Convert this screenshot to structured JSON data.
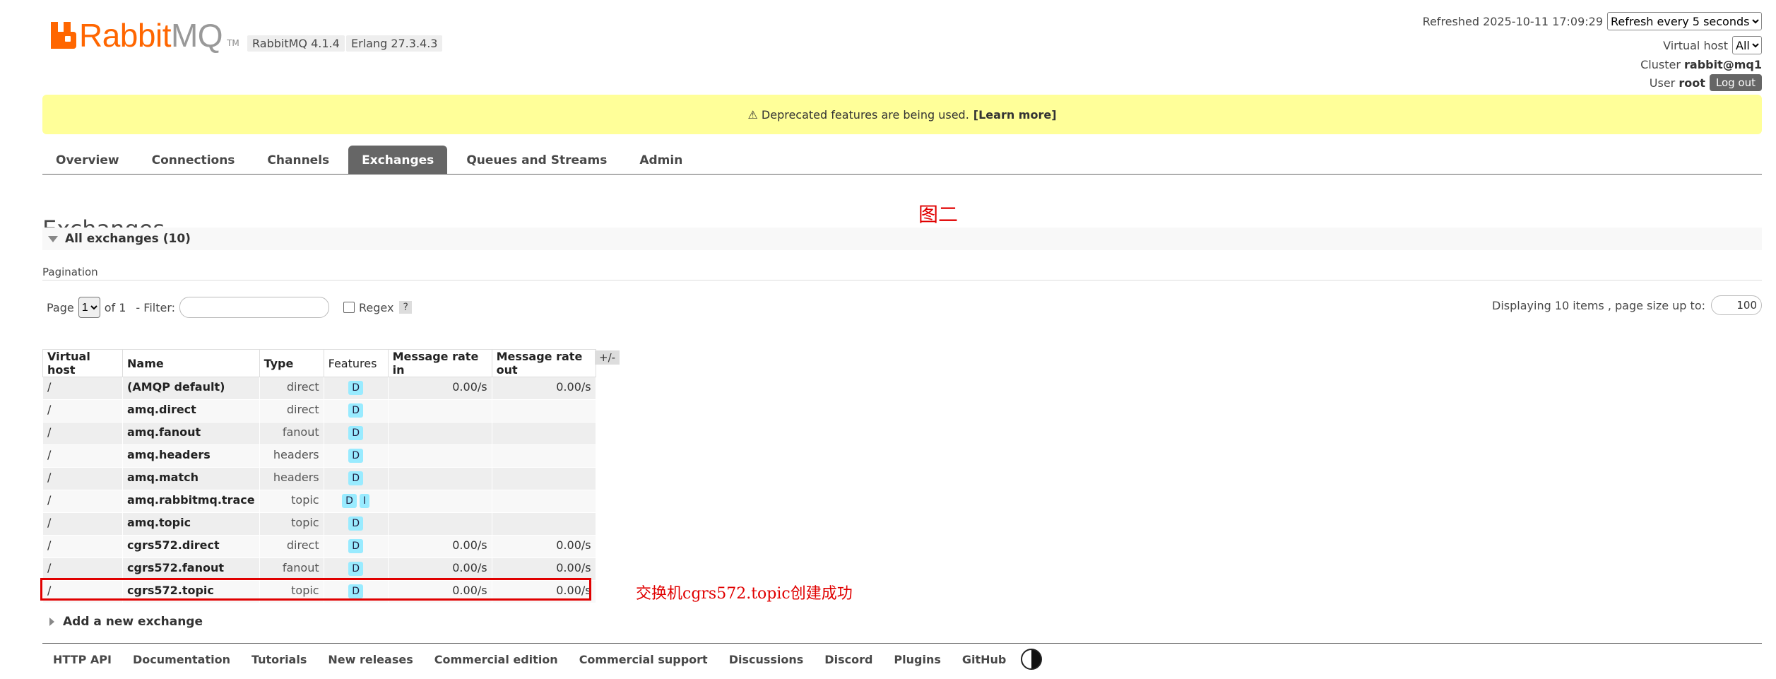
{
  "logo": {
    "word1": "Rabbit",
    "word2": "MQ",
    "tm": "TM",
    "version": "RabbitMQ 4.1.4",
    "erlang": "Erlang 27.3.4.3"
  },
  "topright": {
    "refreshed": "Refreshed 2025-10-11 17:09:29",
    "refresh_option": "Refresh every 5 seconds",
    "vhost_label": "Virtual host",
    "vhost_value": "All",
    "cluster_label": "Cluster",
    "cluster_value": "rabbit@mq1",
    "user_label": "User",
    "user_value": "root",
    "logout": "Log out"
  },
  "banner": {
    "text": "⚠ Deprecated features are being used.",
    "link": "[Learn more]"
  },
  "tabs": [
    {
      "label": "Overview"
    },
    {
      "label": "Connections"
    },
    {
      "label": "Channels"
    },
    {
      "label": "Exchanges",
      "active": true
    },
    {
      "label": "Queues and Streams"
    },
    {
      "label": "Admin"
    }
  ],
  "page_title": "Exchanges",
  "annotation_top": "图二",
  "section": {
    "title": "All exchanges (10)"
  },
  "pagination": {
    "label": "Pagination",
    "page_label": "Page",
    "page_value": "1",
    "of": "of 1",
    "filter_label": "- Filter:",
    "regex_label": "Regex",
    "help": "?",
    "display_text": "Displaying 10 items , page size up to:",
    "page_size": "100"
  },
  "table": {
    "headers": [
      "Virtual host",
      "Name",
      "Type",
      "Features",
      "Message rate in",
      "Message rate out"
    ],
    "plusminus": "+/-",
    "rows": [
      {
        "vhost": "/",
        "name": "(AMQP default)",
        "type": "direct",
        "features": [
          "D"
        ],
        "in": "0.00/s",
        "out": "0.00/s"
      },
      {
        "vhost": "/",
        "name": "amq.direct",
        "type": "direct",
        "features": [
          "D"
        ],
        "in": "",
        "out": ""
      },
      {
        "vhost": "/",
        "name": "amq.fanout",
        "type": "fanout",
        "features": [
          "D"
        ],
        "in": "",
        "out": ""
      },
      {
        "vhost": "/",
        "name": "amq.headers",
        "type": "headers",
        "features": [
          "D"
        ],
        "in": "",
        "out": ""
      },
      {
        "vhost": "/",
        "name": "amq.match",
        "type": "headers",
        "features": [
          "D"
        ],
        "in": "",
        "out": ""
      },
      {
        "vhost": "/",
        "name": "amq.rabbitmq.trace",
        "type": "topic",
        "features": [
          "D",
          "I"
        ],
        "in": "",
        "out": ""
      },
      {
        "vhost": "/",
        "name": "amq.topic",
        "type": "topic",
        "features": [
          "D"
        ],
        "in": "",
        "out": ""
      },
      {
        "vhost": "/",
        "name": "cgrs572.direct",
        "type": "direct",
        "features": [
          "D"
        ],
        "in": "0.00/s",
        "out": "0.00/s"
      },
      {
        "vhost": "/",
        "name": "cgrs572.fanout",
        "type": "fanout",
        "features": [
          "D"
        ],
        "in": "0.00/s",
        "out": "0.00/s"
      },
      {
        "vhost": "/",
        "name": "cgrs572.topic",
        "type": "topic",
        "features": [
          "D"
        ],
        "in": "0.00/s",
        "out": "0.00/s"
      }
    ]
  },
  "annotation_row": "交换机cgrs572.topic创建成功",
  "add_new": "Add a new exchange",
  "footer": [
    "HTTP API",
    "Documentation",
    "Tutorials",
    "New releases",
    "Commercial edition",
    "Commercial support",
    "Discussions",
    "Discord",
    "Plugins",
    "GitHub"
  ],
  "colors": {
    "brand": "#ff6600",
    "banner": "#ffff99",
    "active_tab": "#666666",
    "annotation": "#e00000",
    "feature_badge": "#99ebff"
  }
}
